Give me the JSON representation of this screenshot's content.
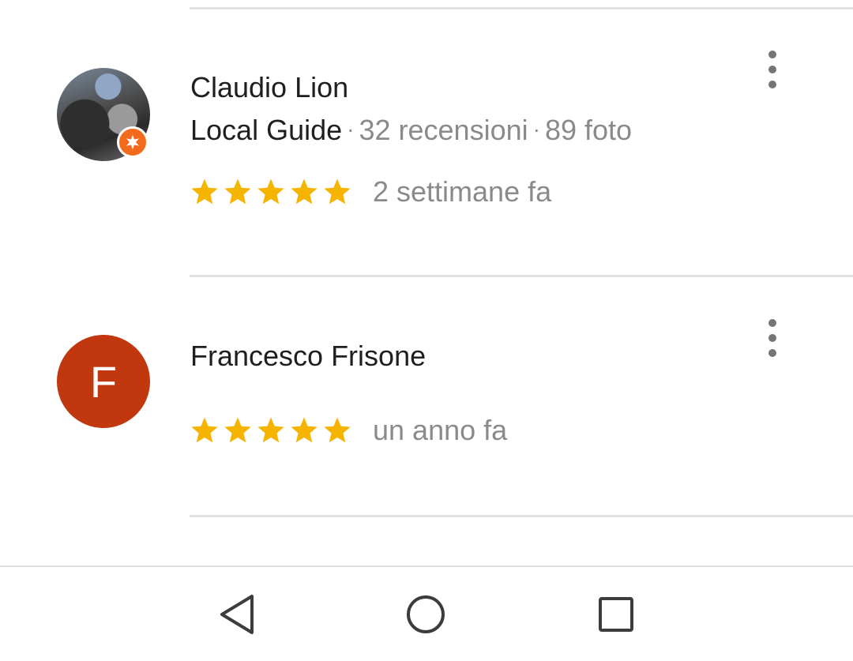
{
  "reviews": [
    {
      "author": "Claudio Lion",
      "guide_label": "Local Guide",
      "separator": "·",
      "reviews_count": "32 recensioni",
      "photos_count": "89 foto",
      "rating": 5,
      "time": "2 settimane fa",
      "avatar_icon": "profile-photo"
    },
    {
      "author": "Francesco Frisone",
      "avatar_letter": "F",
      "rating": 5,
      "time": "un anno fa",
      "avatar_color": "#c1380f"
    }
  ],
  "colors": {
    "star": "#f5b400",
    "guide_badge": "#f26a1b",
    "secondary_text": "#8a8a8a"
  },
  "navbar": {
    "icons": [
      "back-icon",
      "home-icon",
      "recents-icon"
    ]
  }
}
